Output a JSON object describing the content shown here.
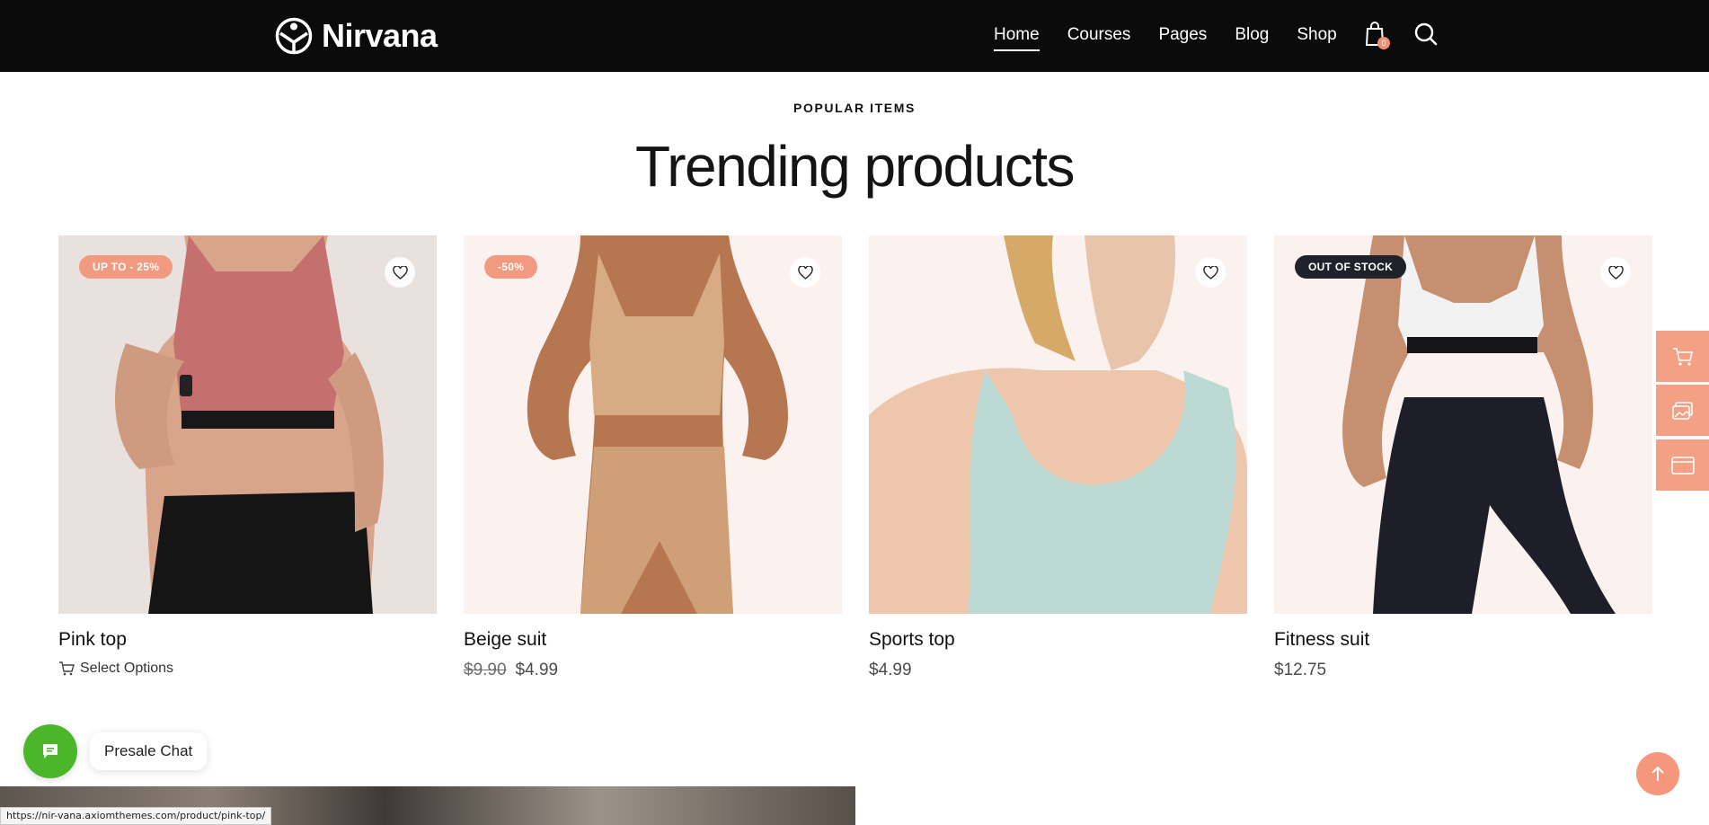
{
  "brand": {
    "name": "Nirvana"
  },
  "nav": {
    "items": [
      {
        "label": "Home",
        "active": true
      },
      {
        "label": "Courses",
        "active": false
      },
      {
        "label": "Pages",
        "active": false
      },
      {
        "label": "Blog",
        "active": false
      },
      {
        "label": "Shop",
        "active": false
      }
    ],
    "cart_count": "0"
  },
  "section": {
    "eyebrow": "POPULAR ITEMS",
    "title": "Trending products"
  },
  "products": [
    {
      "title": "Pink top",
      "badge": "UP TO - 25%",
      "badge_type": "sale",
      "action": "Select Options",
      "price_old": "",
      "price": ""
    },
    {
      "title": "Beige suit",
      "badge": "-50%",
      "badge_type": "sale",
      "action": "",
      "price_old": "$9.90",
      "price": "$4.99"
    },
    {
      "title": "Sports top",
      "badge": "",
      "badge_type": "",
      "action": "",
      "price_old": "",
      "price": "$4.99"
    },
    {
      "title": "Fitness suit",
      "badge": "OUT OF STOCK",
      "badge_type": "out",
      "action": "",
      "price_old": "",
      "price": "$12.75"
    }
  ],
  "side_tools": [
    "cart-icon",
    "gallery-icon",
    "browser-window-icon"
  ],
  "chat": {
    "label": "Presale Chat"
  },
  "status_url": "https://nir-vana.axiomthemes.com/product/pink-top/",
  "colors": {
    "accent": "#f4a084",
    "header_bg": "#0b0b0b",
    "chat_green": "#4cb62a",
    "badge_dark": "#1f222a"
  }
}
